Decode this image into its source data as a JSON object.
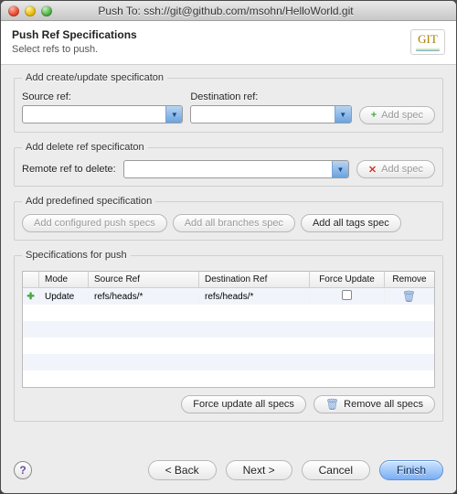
{
  "window": {
    "title": "Push To: ssh://git@github.com/msohn/HelloWorld.git"
  },
  "header": {
    "title": "Push Ref Specifications",
    "subtitle": "Select refs to push.",
    "badge": "GIT"
  },
  "sections": {
    "create": {
      "legend": "Add create/update specificaton",
      "source_label": "Source ref:",
      "dest_label": "Destination ref:",
      "source_value": "",
      "dest_value": "",
      "add_label": "Add spec"
    },
    "delete": {
      "legend": "Add delete ref specificaton",
      "remote_label": "Remote ref to delete:",
      "remote_value": "",
      "add_label": "Add spec"
    },
    "predef": {
      "legend": "Add predefined specification",
      "configured": "Add configured push specs",
      "branches": "Add all branches spec",
      "tags": "Add all tags spec"
    },
    "specs": {
      "legend": "Specifications for push",
      "columns": {
        "mode": "Mode",
        "source": "Source Ref",
        "dest": "Destination Ref",
        "force": "Force Update",
        "remove": "Remove"
      },
      "rows": [
        {
          "mode": "Update",
          "source": "refs/heads/*",
          "dest": "refs/heads/*",
          "force": false
        }
      ],
      "force_all": "Force update all specs",
      "remove_all": "Remove all specs"
    }
  },
  "footer": {
    "back": "< Back",
    "next": "Next >",
    "cancel": "Cancel",
    "finish": "Finish"
  }
}
